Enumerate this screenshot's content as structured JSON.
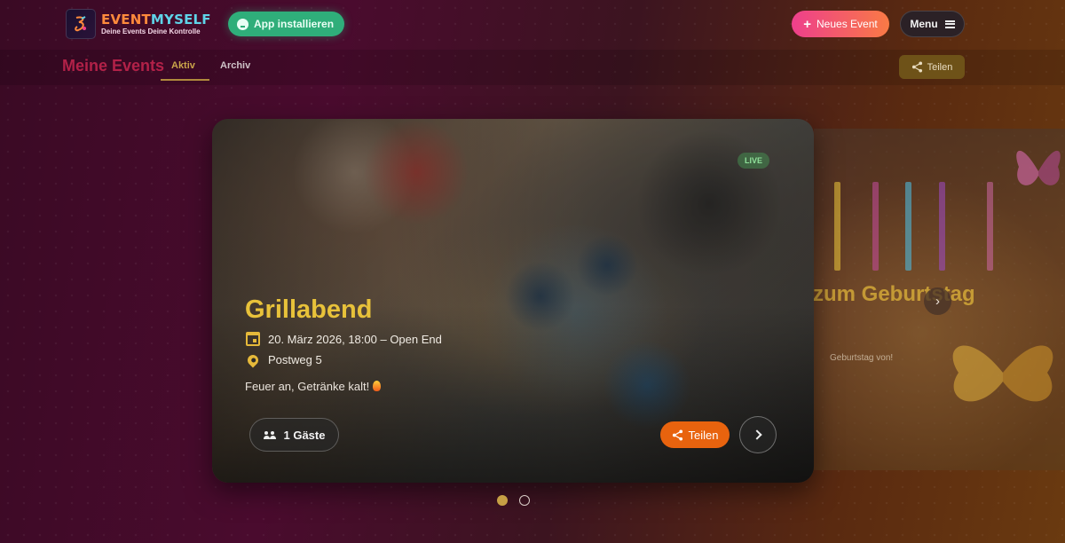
{
  "header": {
    "logo": {
      "name_part1": "EVENT",
      "name_part2": "MYSELF",
      "tagline": "Deine Events Deine Kontrolle"
    },
    "install_label": "App installieren",
    "new_event_label": "Neues Event",
    "menu_label": "Menu"
  },
  "subnav": {
    "title": "Meine Events",
    "tabs": [
      {
        "label": "Aktiv",
        "active": true
      },
      {
        "label": "Archiv",
        "active": false
      }
    ],
    "share_label": "Teilen"
  },
  "event": {
    "badge": "LIVE",
    "title": "Grillabend",
    "date": "20. März 2026, 18:00 – Open End",
    "location": "Postweg 5",
    "description": "Feuer an, Getränke kalt!",
    "guests_label": "1 Gäste",
    "share_label": "Teilen"
  },
  "next_event": {
    "title": "zum Geburtstag",
    "subtitle": "Geburtstag von!"
  },
  "carousel": {
    "count": 2,
    "active_index": 0
  },
  "colors": {
    "accent_gold": "#e8c23a",
    "share_orange": "#e8630e",
    "install_green": "#2fae7a",
    "new_event_gradient": [
      "#ee3f8c",
      "#f97a45"
    ]
  }
}
